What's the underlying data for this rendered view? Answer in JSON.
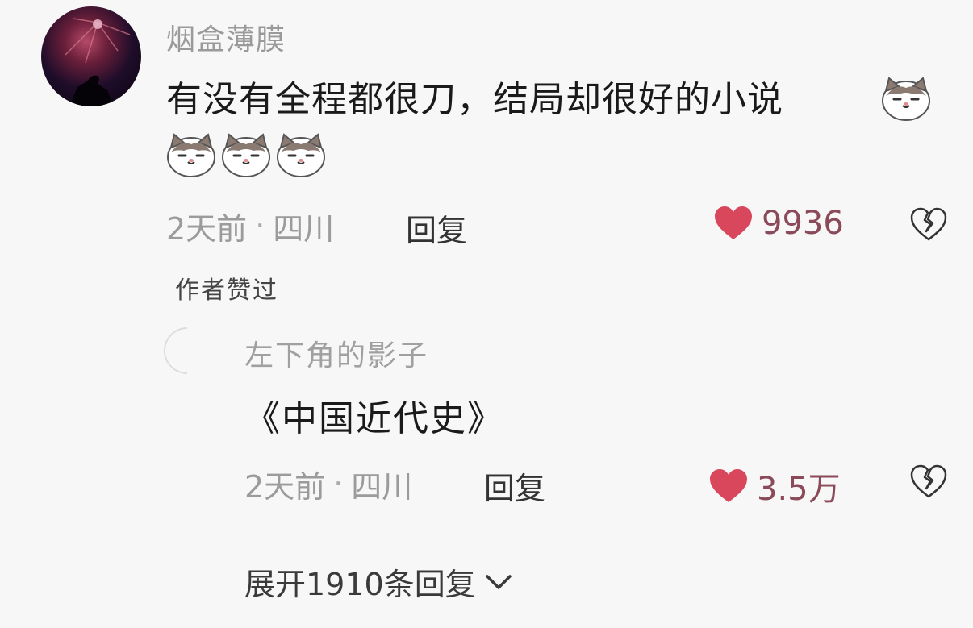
{
  "comment": {
    "avatar_icon": "night-sky-avatar-icon",
    "username": "烟盒薄膜",
    "text": "有没有全程都很刀，结局却很好的小说",
    "emoji_icon": "cat-face-emoji-icon",
    "emoji_count": 4,
    "time": "2天前",
    "separator": "·",
    "location": "四川",
    "reply_label": "回复",
    "like_count": "9936",
    "like_icon": "heart-icon",
    "dislike_icon": "broken-heart-icon",
    "author_badge": "作者赞过"
  },
  "reply": {
    "username": "左下角的影子",
    "text": "《中国近代史》",
    "time": "2天前",
    "separator": "·",
    "location": "四川",
    "reply_label": "回复",
    "like_count": "3.5万",
    "like_icon": "heart-icon",
    "dislike_icon": "broken-heart-icon"
  },
  "expand_label": "展开1910条回复",
  "colors": {
    "heart": "#d9475d",
    "like_text": "#8b4a5a",
    "muted": "#9b9b9b",
    "text": "#1a1a1a"
  }
}
